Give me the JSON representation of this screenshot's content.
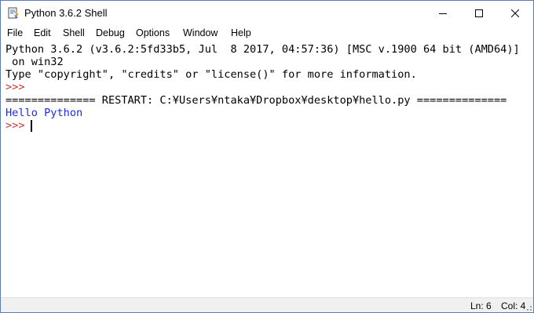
{
  "window": {
    "title": "Python 3.6.2 Shell",
    "icon": "idle-app-icon"
  },
  "caption_buttons": {
    "minimize": "minimize-icon",
    "maximize": "maximize-icon",
    "close": "close-icon"
  },
  "menu": {
    "items": [
      {
        "label": "File"
      },
      {
        "label": "Edit"
      },
      {
        "label": "Shell"
      },
      {
        "label": "Debug"
      },
      {
        "label": "Options"
      },
      {
        "label": "Window"
      },
      {
        "label": "Help"
      }
    ]
  },
  "shell": {
    "lines": [
      {
        "text": "Python 3.6.2 (v3.6.2:5fd33b5, Jul  8 2017, 04:57:36) [MSC v.1900 64 bit (AMD64)]",
        "kind": "output"
      },
      {
        "text": " on win32",
        "kind": "output"
      },
      {
        "text": "Type \"copyright\", \"credits\" or \"license()\" for more information.",
        "kind": "output"
      },
      {
        "text": ">>> ",
        "kind": "prompt"
      },
      {
        "text": "============== RESTART: C:¥Users¥ntaka¥Dropbox¥desktop¥hello.py ==============",
        "kind": "output"
      },
      {
        "text": "Hello Python",
        "kind": "stdout"
      },
      {
        "text": ">>> ",
        "kind": "prompt"
      }
    ]
  },
  "status": {
    "line": "Ln: 6",
    "col": "Col: 4"
  },
  "colors": {
    "prompt": "#c0393a",
    "stdout": "#1a2ed6",
    "window_border": "#5a7db8"
  }
}
